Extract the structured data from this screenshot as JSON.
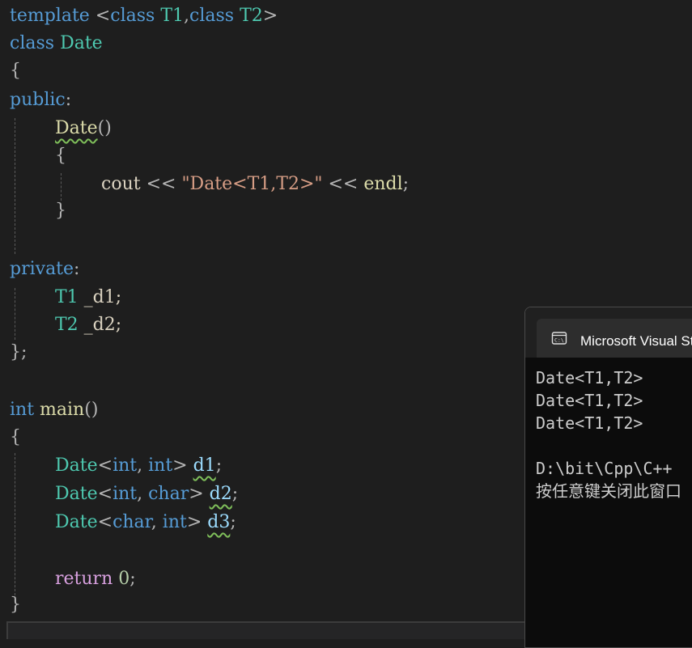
{
  "editor": {
    "lines": {
      "l1": {
        "kw1": "template",
        "p1": " <",
        "kw2": "class",
        "sp": " ",
        "t1": "T1",
        "p2": ",",
        "kw3": "class",
        "sp2": " ",
        "t2": "T2",
        "p3": ">"
      },
      "l2": {
        "kw": "class",
        "sp": " ",
        "ty": "Date"
      },
      "l3": {
        "p": "{"
      },
      "l4": {
        "kw": "public",
        "p": ":"
      },
      "l5": {
        "fn": "Date",
        "p": "()"
      },
      "l6": {
        "p": "{"
      },
      "l7": {
        "id": "cout",
        "p1": " << ",
        "str": "\"Date<T1,T2>\"",
        "p2": " << ",
        "fn": "endl",
        "p3": ";"
      },
      "l8": {
        "p": "}"
      },
      "l9": {
        "kw": "private",
        "p": ":"
      },
      "l10": {
        "ty": "T1",
        "rest": " _d1;"
      },
      "l11": {
        "ty": "T2",
        "rest": " _d2;"
      },
      "l12": {
        "p": "};"
      },
      "l13": {
        "kw": "int",
        "sp": " ",
        "fn": "main",
        "p": "()"
      },
      "l14": {
        "p": "{"
      },
      "l15": {
        "ty": "Date",
        "p1": "<",
        "kw1": "int",
        "p2": ", ",
        "kw2": "int",
        "p3": "> ",
        "var": "d1",
        "p4": ";"
      },
      "l16": {
        "ty": "Date",
        "p1": "<",
        "kw1": "int",
        "p2": ", ",
        "kw2": "char",
        "p3": "> ",
        "var": "d2",
        "p4": ";"
      },
      "l17": {
        "ty": "Date",
        "p1": "<",
        "kw1": "char",
        "p2": ", ",
        "kw2": "int",
        "p3": "> ",
        "var": "d3",
        "p4": ";"
      },
      "l18": {
        "ctl": "return",
        "sp": " ",
        "num": "0",
        "p": ";"
      },
      "l19": {
        "p": "}"
      }
    }
  },
  "console": {
    "title": "Microsoft Visual Studio 调试控制台",
    "icon": "console-icon",
    "output": [
      "Date<T1,T2>",
      "Date<T1,T2>",
      "Date<T1,T2>",
      "",
      "D:\\bit\\Cpp\\C++",
      "按任意键关闭此窗口"
    ]
  }
}
